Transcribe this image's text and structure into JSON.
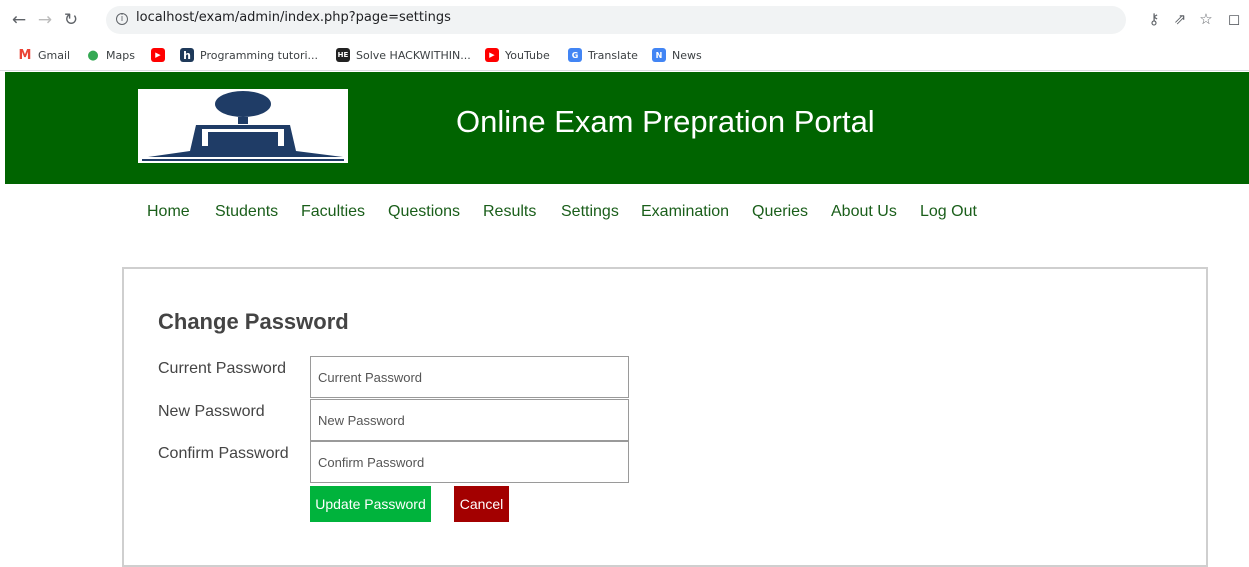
{
  "browser": {
    "url": "localhost/exam/admin/index.php?page=settings",
    "bookmarks": [
      {
        "label": "Gmail",
        "icon": "gmail-icon",
        "color": "#ea4335"
      },
      {
        "label": "Maps",
        "icon": "maps-icon",
        "color": "#34a853"
      },
      {
        "label": "",
        "icon": "youtube-icon",
        "color": "#ff0000"
      },
      {
        "label": "Programming tutori...",
        "icon": "h-icon",
        "color": "#1f3a5a"
      },
      {
        "label": "Solve HACKWITHIN...",
        "icon": "hackerearth-icon",
        "color": "#222222"
      },
      {
        "label": "YouTube",
        "icon": "youtube-icon",
        "color": "#ff0000"
      },
      {
        "label": "Translate",
        "icon": "translate-icon",
        "color": "#4285f4"
      },
      {
        "label": "News",
        "icon": "news-icon",
        "color": "#4285f4"
      }
    ]
  },
  "site": {
    "title": "Online Exam Prepration Portal",
    "banner_color": "#006400",
    "nav": [
      "Home",
      "Students",
      "Faculties",
      "Questions",
      "Results",
      "Settings",
      "Examination",
      "Queries",
      "About Us",
      "Log Out"
    ]
  },
  "form": {
    "title": "Change Password",
    "fields": [
      {
        "label": "Current Password",
        "placeholder": "Current Password"
      },
      {
        "label": "New Password",
        "placeholder": "New Password"
      },
      {
        "label": "Confirm Password",
        "placeholder": "Confirm Password"
      }
    ],
    "update_label": "Update Password",
    "cancel_label": "Cancel",
    "update_color": "#00b33c",
    "cancel_color": "#a30000"
  }
}
